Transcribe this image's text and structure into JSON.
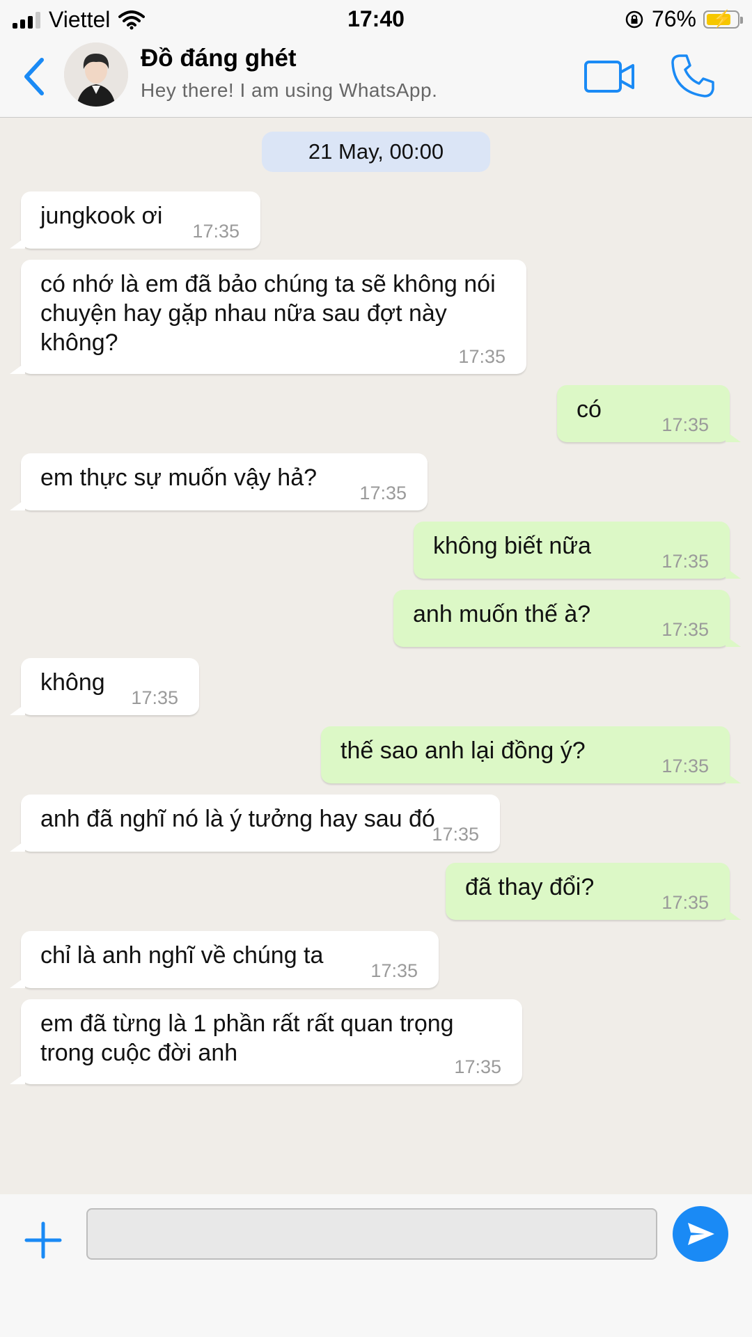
{
  "status_bar": {
    "carrier": "Viettel",
    "time": "17:40",
    "battery": "76%",
    "icons": [
      "signal-icon",
      "wifi-icon",
      "orientation-lock-icon",
      "battery-charging-icon"
    ]
  },
  "header": {
    "name": "Đồ đáng ghét",
    "status": "Hey there! I am using WhatsApp.",
    "icons": [
      "back-chevron-icon",
      "video-call-icon",
      "phone-icon"
    ]
  },
  "chat": {
    "date": "21 May, 00:00",
    "messages": [
      {
        "dir": "in",
        "text": "jungkook ơi",
        "time": "17:35"
      },
      {
        "dir": "in",
        "text": "có nhớ là em đã bảo chúng ta sẽ không nói chuyện hay gặp nhau nữa sau đợt này không?",
        "time": "17:35"
      },
      {
        "dir": "out",
        "text": "có",
        "time": "17:35"
      },
      {
        "dir": "in",
        "text": "em thực sự muốn vậy hả?",
        "time": "17:35"
      },
      {
        "dir": "out",
        "text": "không biết nữa",
        "time": "17:35"
      },
      {
        "dir": "out",
        "text": "anh muốn thế à?",
        "time": "17:35"
      },
      {
        "dir": "in",
        "text": "không",
        "time": "17:35"
      },
      {
        "dir": "out",
        "text": "thế sao anh lại đồng ý?",
        "time": "17:35"
      },
      {
        "dir": "in",
        "text": "anh đã nghĩ nó là ý tưởng hay sau đó",
        "time": "17:35"
      },
      {
        "dir": "out",
        "text": "đã thay đổi?",
        "time": "17:35"
      },
      {
        "dir": "in",
        "text": "chỉ là anh nghĩ về chúng ta",
        "time": "17:35"
      },
      {
        "dir": "in",
        "text": "em đã từng là 1 phần rất rất quan trọng trong cuộc đời anh",
        "time": "17:35"
      }
    ]
  },
  "composer": {
    "value": "",
    "placeholder": "",
    "icons": [
      "plus-icon",
      "send-icon"
    ]
  },
  "colors": {
    "accent": "#1a8af5",
    "outgoing_bubble": "#dcf8c6",
    "incoming_bubble": "#ffffff",
    "date_pill": "#dbe5f6",
    "battery": "#f6c700"
  }
}
